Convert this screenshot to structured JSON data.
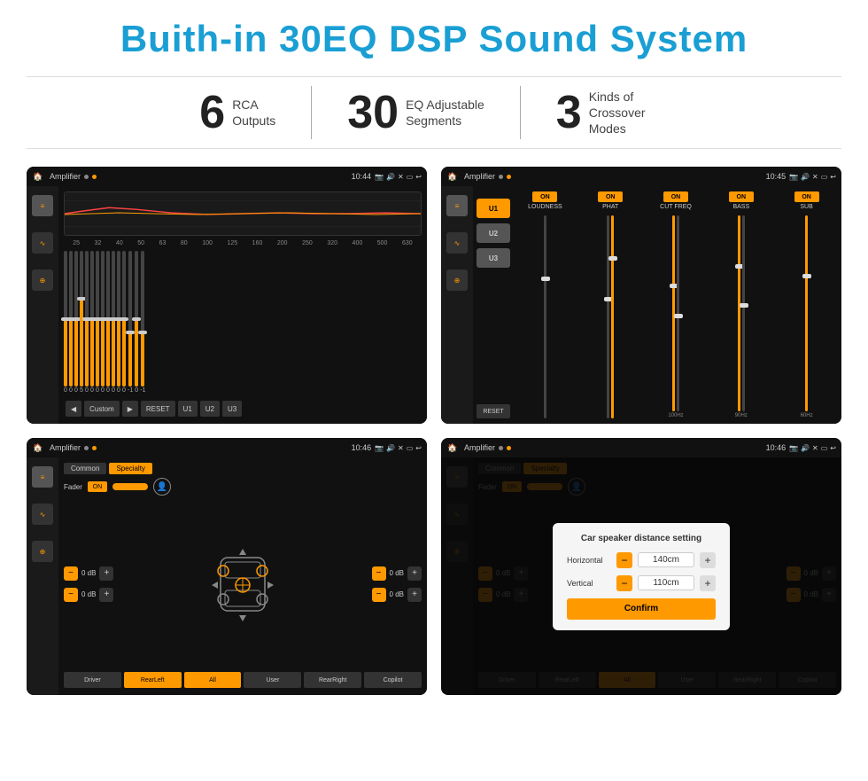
{
  "page": {
    "title": "Buith-in 30EQ DSP Sound System"
  },
  "stats": [
    {
      "number": "6",
      "label": "RCA\nOutputs"
    },
    {
      "number": "30",
      "label": "EQ Adjustable\nSegments"
    },
    {
      "number": "3",
      "label": "Kinds of\nCrossover Modes"
    }
  ],
  "screens": [
    {
      "id": "eq-screen",
      "topbar": {
        "title": "Amplifier",
        "time": "10:44"
      }
    },
    {
      "id": "crossover-screen",
      "topbar": {
        "title": "Amplifier",
        "time": "10:45"
      }
    },
    {
      "id": "fader-screen",
      "topbar": {
        "title": "Amplifier",
        "time": "10:46"
      }
    },
    {
      "id": "distance-screen",
      "topbar": {
        "title": "Amplifier",
        "time": "10:46"
      },
      "dialog": {
        "title": "Car speaker distance setting",
        "horizontal_label": "Horizontal",
        "horizontal_value": "140cm",
        "vertical_label": "Vertical",
        "vertical_value": "110cm",
        "confirm_label": "Confirm"
      }
    }
  ],
  "eq_freqs": [
    "25",
    "32",
    "40",
    "50",
    "63",
    "80",
    "100",
    "125",
    "160",
    "200",
    "250",
    "320",
    "400",
    "500",
    "630"
  ],
  "eq_values": [
    "0",
    "0",
    "0",
    "5",
    "0",
    "0",
    "0",
    "0",
    "0",
    "0",
    "0",
    "0",
    "-1",
    "0",
    "-1"
  ],
  "eq_sliders": [
    50,
    50,
    50,
    65,
    50,
    50,
    50,
    50,
    50,
    50,
    50,
    50,
    40,
    50,
    40
  ],
  "crossover_channels": [
    {
      "name": "LOUDNESS",
      "on": true
    },
    {
      "name": "PHAT",
      "on": true
    },
    {
      "name": "CUT FREQ",
      "on": true
    },
    {
      "name": "BASS",
      "on": true
    },
    {
      "name": "SUB",
      "on": true
    }
  ],
  "xo_presets": [
    "U1",
    "U2",
    "U3"
  ],
  "fader_tabs": [
    "Common",
    "Specialty"
  ],
  "fader_labels": [
    "Driver",
    "RearLeft",
    "All",
    "User",
    "RearRight",
    "Copilot"
  ],
  "fader_db_values": [
    "0 dB",
    "0 dB",
    "0 dB",
    "0 dB"
  ],
  "buttons": {
    "eq_custom": "Custom",
    "eq_reset": "RESET",
    "eq_u1": "U1",
    "eq_u2": "U2",
    "eq_u3": "U3",
    "xo_reset": "RESET",
    "confirm": "Confirm"
  }
}
